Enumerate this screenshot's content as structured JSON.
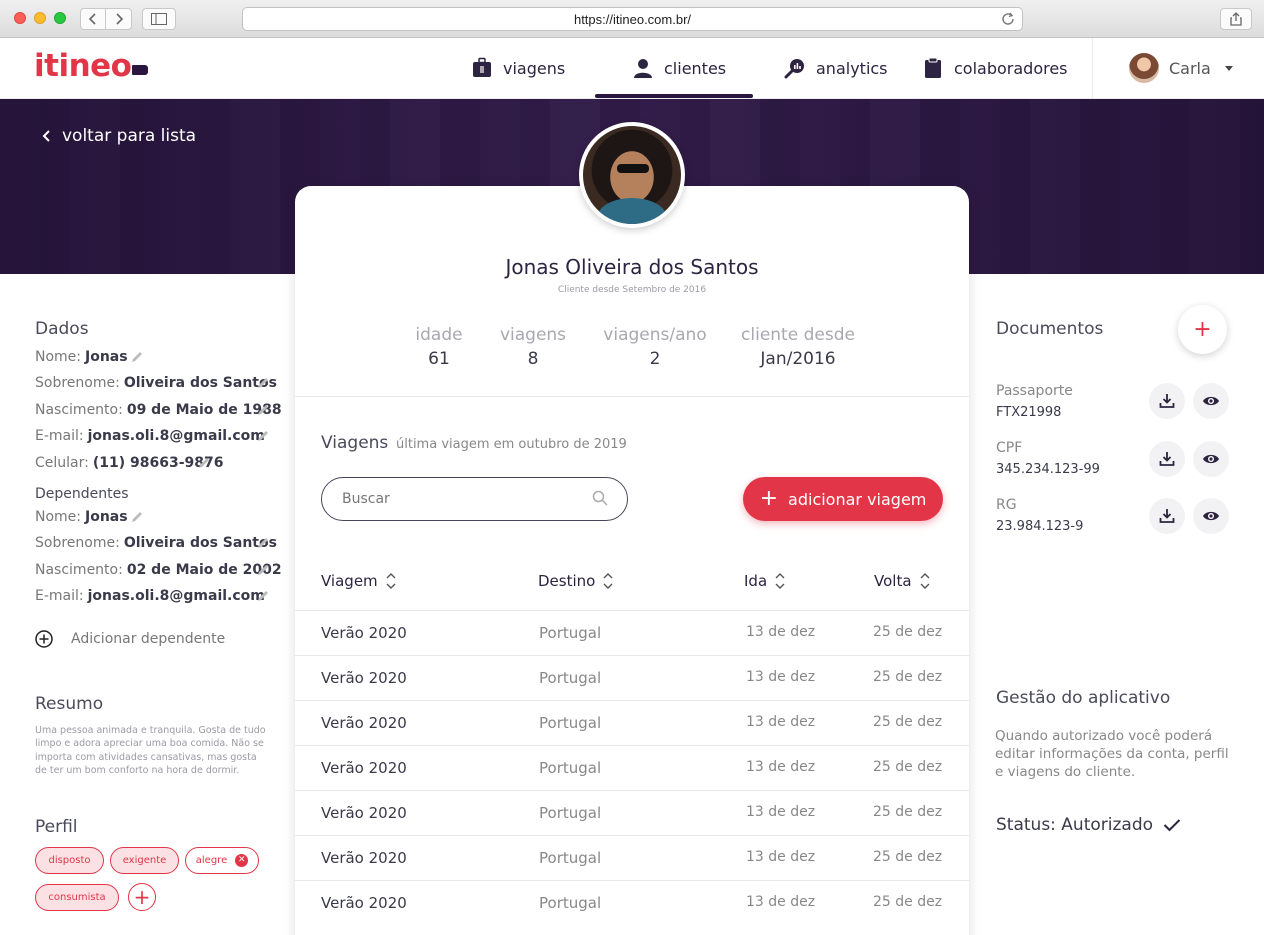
{
  "browser": {
    "url": "https://itineo.com.br/"
  },
  "app": {
    "logo": "itineo",
    "nav": [
      {
        "label": "viagens",
        "icon": "luggage-icon"
      },
      {
        "label": "clientes",
        "icon": "user-icon",
        "active": true
      },
      {
        "label": "analytics",
        "icon": "analytics-search-icon"
      },
      {
        "label": "colaboradores",
        "icon": "clipboard-icon"
      }
    ],
    "user": {
      "name": "Carla"
    }
  },
  "hero": {
    "back_label": "voltar para lista"
  },
  "profile": {
    "name": "Jonas Oliveira dos Santos",
    "since": "Cliente desde Setembro de 2016",
    "stats": [
      {
        "label": "idade",
        "value": "61"
      },
      {
        "label": "viagens",
        "value": "8"
      },
      {
        "label": "viagens/ano",
        "value": "2"
      },
      {
        "label": "cliente desde",
        "value": "Jan/2016"
      }
    ]
  },
  "trips": {
    "title": "Viagens",
    "subtitle": "última viagem em outubro de 2019",
    "search_placeholder": "Buscar",
    "add_label": "adicionar viagem",
    "columns": [
      "Viagem",
      "Destino",
      "Ida",
      "Volta"
    ],
    "rows": [
      [
        "Verão 2020",
        "Portugal",
        "13 de dez",
        "25 de dez"
      ],
      [
        "Verão 2020",
        "Portugal",
        "13 de dez",
        "25 de dez"
      ],
      [
        "Verão 2020",
        "Portugal",
        "13 de dez",
        "25 de dez"
      ],
      [
        "Verão 2020",
        "Portugal",
        "13 de dez",
        "25 de dez"
      ],
      [
        "Verão 2020",
        "Portugal",
        "13 de dez",
        "25 de dez"
      ],
      [
        "Verão 2020",
        "Portugal",
        "13 de dez",
        "25 de dez"
      ],
      [
        "Verão 2020",
        "Portugal",
        "13 de dez",
        "25 de dez"
      ]
    ]
  },
  "dados": {
    "title": "Dados",
    "fields": [
      {
        "label": "Nome:",
        "value": "Jonas"
      },
      {
        "label": "Sobrenome:",
        "value": "Oliveira dos Santos"
      },
      {
        "label": "Nascimento:",
        "value": "09 de Maio de 1988"
      },
      {
        "label": "E-mail:",
        "value": "jonas.oli.8@gmail.com"
      },
      {
        "label": "Celular:",
        "value": "(11) 98663-9876"
      }
    ]
  },
  "dependentes": {
    "title": "Dependentes",
    "fields": [
      {
        "label": "Nome:",
        "value": "Jonas"
      },
      {
        "label": "Sobrenome:",
        "value": "Oliveira dos Santos"
      },
      {
        "label": "Nascimento:",
        "value": "02 de Maio de 2002"
      },
      {
        "label": "E-mail:",
        "value": "jonas.oli.8@gmail.com"
      }
    ],
    "add_label": "Adicionar dependente"
  },
  "resumo": {
    "title": "Resumo",
    "text": "Uma pessoa animada e tranquila. Gosta de tudo limpo e adora apreciar uma boa comida. Não se importa com atividades cansativas, mas gosta de ter um bom conforto na hora de dormir."
  },
  "perfil": {
    "title": "Perfil",
    "tags": [
      "disposto",
      "exigente",
      "alegre",
      "consumista"
    ]
  },
  "documentos": {
    "title": "Documentos",
    "items": [
      {
        "label": "Passaporte",
        "value": "FTX21998"
      },
      {
        "label": "CPF",
        "value": "345.234.123-99"
      },
      {
        "label": "RG",
        "value": "23.984.123-9"
      }
    ]
  },
  "gestao": {
    "title": "Gestão do aplicativo",
    "text": "Quando autorizado você poderá editar informações da conta, perfil e viagens do cliente.",
    "status": "Status: Autorizado"
  },
  "colors": {
    "accent": "#e23648",
    "brand_dark": "#2b1640",
    "tag_fill": "#fbe1e4"
  }
}
